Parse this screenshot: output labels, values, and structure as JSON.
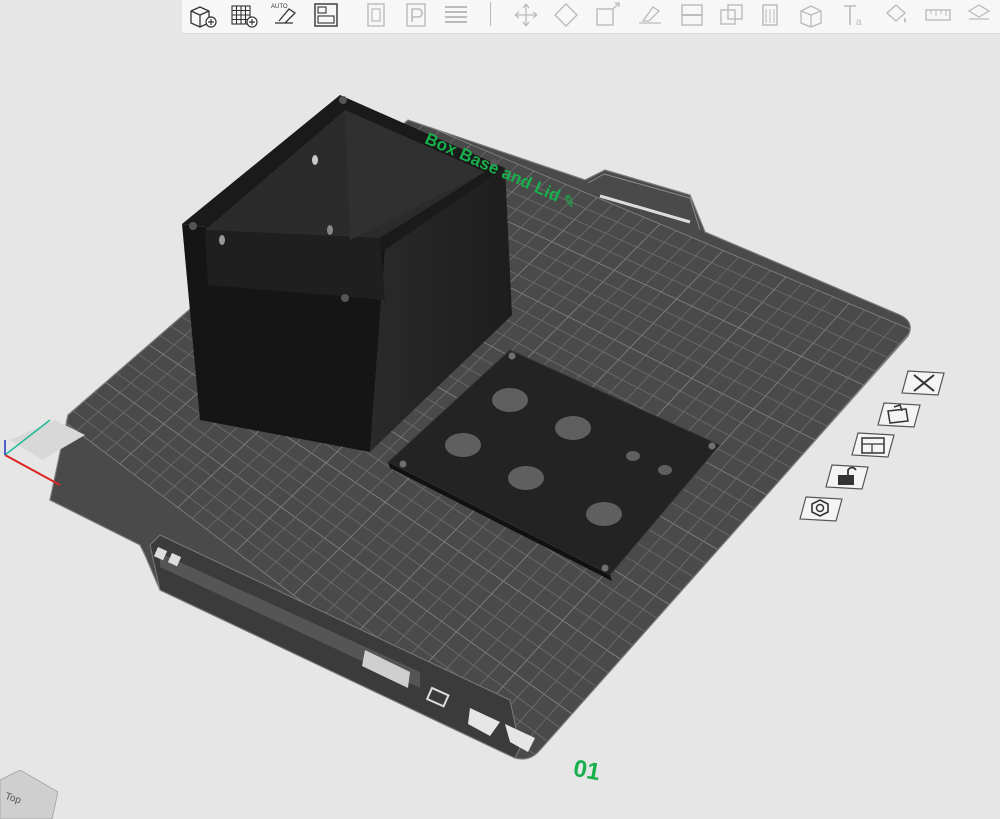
{
  "plate": {
    "title": "Box Base and Lid",
    "title_icon": "pencil-icon",
    "number": "01"
  },
  "view_cube": {
    "label": "Top"
  },
  "toolbar": {
    "buttons": [
      {
        "name": "add-object-button",
        "icon": "cube-plus-icon"
      },
      {
        "name": "add-plate-button",
        "icon": "grid-plus-icon"
      },
      {
        "name": "auto-orient-button",
        "icon": "auto-orient-icon",
        "label": "AUTO"
      },
      {
        "name": "arrange-button",
        "icon": "arrange-icon"
      },
      {
        "name": "slice-layers-button",
        "icon": "layers-icon"
      },
      {
        "name": "plate-settings-button",
        "icon": "p-icon"
      },
      {
        "name": "lines-button",
        "icon": "lines-icon"
      },
      {
        "name": "move-button",
        "icon": "move-icon"
      },
      {
        "name": "rotate-button",
        "icon": "rotate-icon"
      },
      {
        "name": "scale-button",
        "icon": "scale-icon"
      },
      {
        "name": "lay-on-face-button",
        "icon": "lay-flat-icon"
      },
      {
        "name": "cut-button",
        "icon": "cut-icon"
      },
      {
        "name": "boolean-button",
        "icon": "boolean-icon"
      },
      {
        "name": "support-paint-button",
        "icon": "support-paint-icon"
      },
      {
        "name": "seam-paint-button",
        "icon": "seam-icon"
      },
      {
        "name": "text-button",
        "icon": "text-icon"
      },
      {
        "name": "color-paint-button",
        "icon": "paint-bucket-icon"
      },
      {
        "name": "measure-button",
        "icon": "ruler-icon"
      },
      {
        "name": "assembly-button",
        "icon": "assembly-icon"
      }
    ]
  },
  "plate_tools": [
    {
      "name": "remove-plate-button",
      "icon": "close-icon"
    },
    {
      "name": "plate-select-button",
      "icon": "plate-select-icon"
    },
    {
      "name": "arrange-plate-button",
      "icon": "arrange-icon"
    },
    {
      "name": "lock-plate-button",
      "icon": "lock-open-icon"
    },
    {
      "name": "plate-settings-button",
      "icon": "gear-nut-icon"
    }
  ]
}
